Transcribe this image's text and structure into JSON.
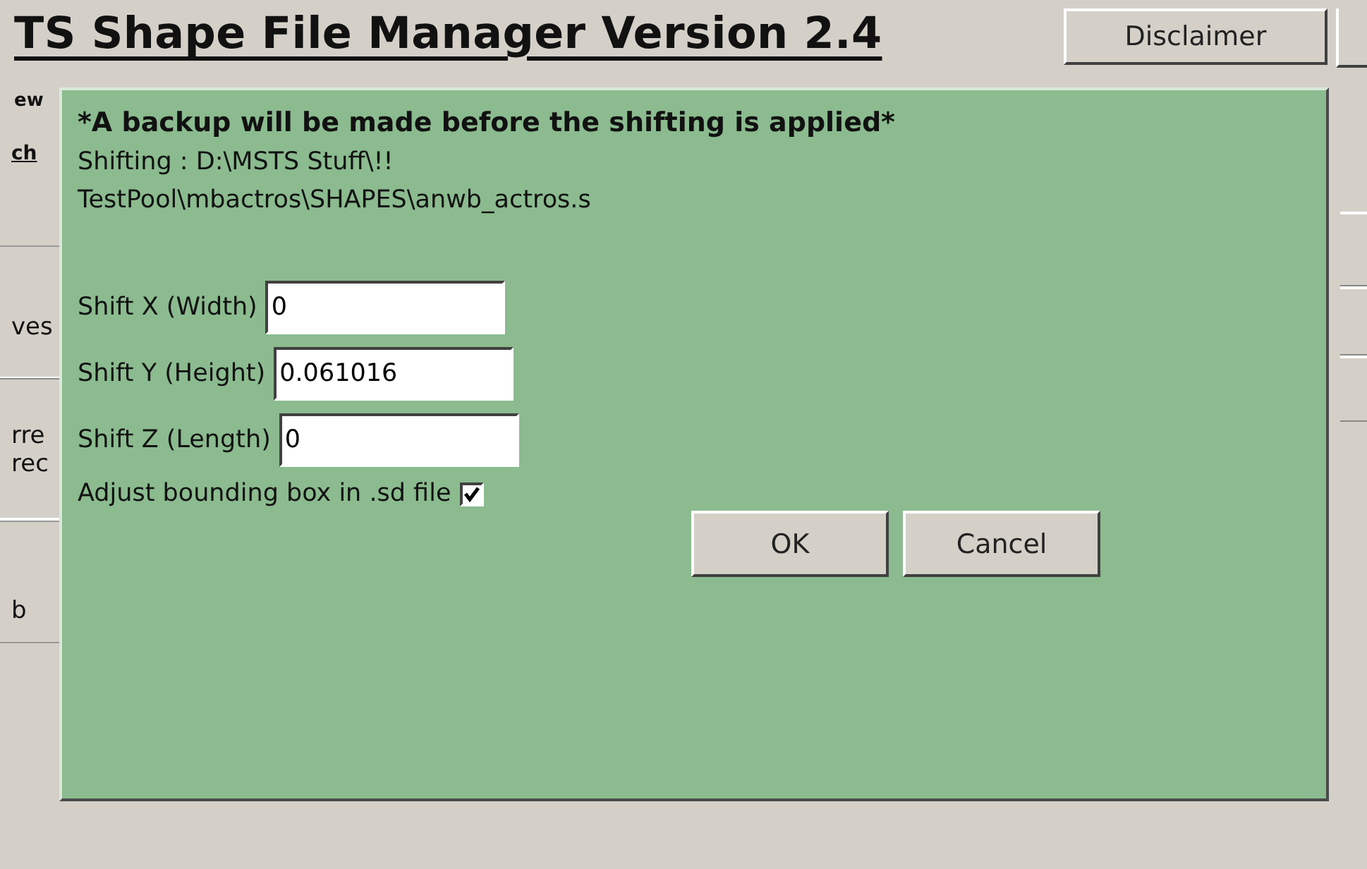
{
  "header": {
    "title": "TS Shape File Manager Version 2.4",
    "disclaimer_button": "Disclaimer"
  },
  "background_fragments": [
    {
      "text": "ew",
      "kind": "bold"
    },
    {
      "text": "ch",
      "kind": "link"
    },
    {
      "text": "ves",
      "kind": "plain"
    },
    {
      "text": "rre",
      "kind": "plain"
    },
    {
      "text": "rec",
      "kind": "plain"
    },
    {
      "text": "b",
      "kind": "plain"
    }
  ],
  "dialog": {
    "warning": "*A backup will be made before the shifting is applied*",
    "path_lines": [
      "Shifting : D:\\MSTS Stuff\\!!",
      "TestPool\\mbactros\\SHAPES\\anwb_actros.s"
    ],
    "fields": [
      {
        "label": "Shift X (Width)",
        "value": "0"
      },
      {
        "label": "Shift Y (Height)",
        "value": "0.061016"
      },
      {
        "label": "Shift Z (Length)",
        "value": "0"
      }
    ],
    "checkbox": {
      "label": "Adjust bounding box in .sd file",
      "checked": true
    },
    "buttons": [
      "OK",
      "Cancel"
    ]
  }
}
